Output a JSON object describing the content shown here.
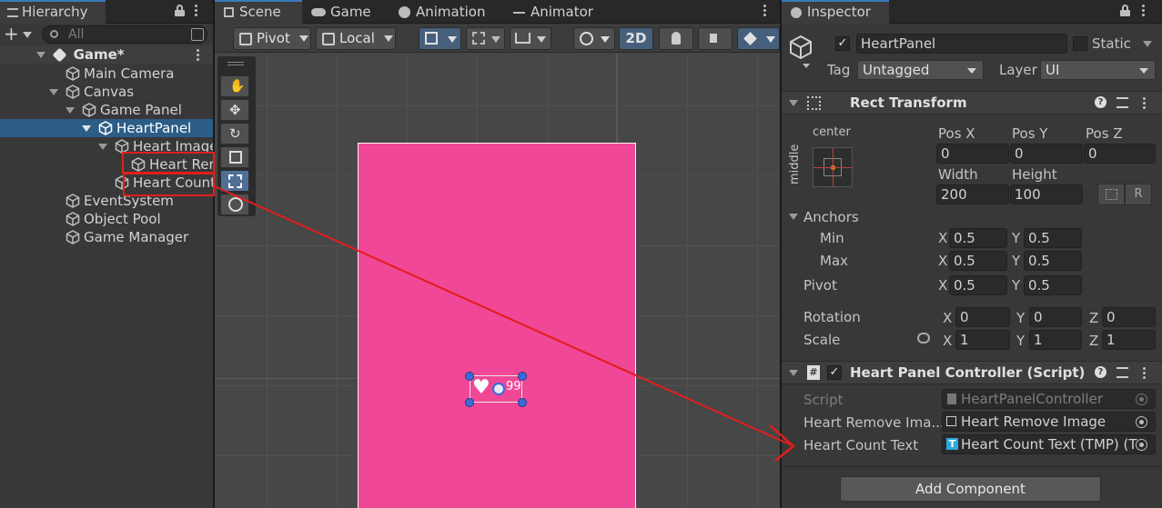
{
  "hierarchy": {
    "tab": "Hierarchy",
    "search_placeholder": "All",
    "scene_name": "Game*",
    "items": [
      {
        "label": "Main Camera"
      },
      {
        "label": "Canvas"
      },
      {
        "label": "Game Panel"
      },
      {
        "label": "HeartPanel"
      },
      {
        "label": "Heart Image"
      },
      {
        "label": "Heart Rer"
      },
      {
        "label": "Heart Count"
      },
      {
        "label": "EventSystem"
      },
      {
        "label": "Object Pool"
      },
      {
        "label": "Game Manager"
      }
    ]
  },
  "scene": {
    "tabs": [
      "Scene",
      "Game",
      "Animation",
      "Animator"
    ],
    "toolbar": {
      "pivot": "Pivot",
      "local": "Local",
      "mode_2d": "2D"
    },
    "heart_count_label": "99",
    "panel_color": "#f04796"
  },
  "inspector": {
    "tab": "Inspector",
    "object_name": "HeartPanel",
    "static_label": "Static",
    "tag_label": "Tag",
    "tag_value": "Untagged",
    "layer_label": "Layer",
    "layer_value": "UI",
    "rect_transform": {
      "title": "Rect Transform",
      "anchor_h": "center",
      "anchor_v": "middle",
      "pos_x_label": "Pos X",
      "pos_x": "0",
      "pos_y_label": "Pos Y",
      "pos_y": "0",
      "pos_z_label": "Pos Z",
      "pos_z": "0",
      "width_label": "Width",
      "width": "200",
      "height_label": "Height",
      "height": "100",
      "anchors_label": "Anchors",
      "min_label": "Min",
      "min_x": "0.5",
      "min_y": "0.5",
      "max_label": "Max",
      "max_x": "0.5",
      "max_y": "0.5",
      "pivot_label": "Pivot",
      "pivot_x": "0.5",
      "pivot_y": "0.5",
      "rotation_label": "Rotation",
      "rot_x": "0",
      "rot_y": "0",
      "rot_z": "0",
      "scale_label": "Scale",
      "scale_x": "1",
      "scale_y": "1",
      "scale_z": "1",
      "x": "X",
      "y": "Y",
      "z": "Z",
      "r_button": "R"
    },
    "script_component": {
      "title": "Heart Panel Controller (Script)",
      "script_label": "Script",
      "script_value": "HeartPanelController",
      "heart_remove_label": "Heart Remove Ima...",
      "heart_remove_value": "Heart Remove Image",
      "heart_count_label": "Heart Count Text",
      "heart_count_value": "Heart Count Text (TMP) (T"
    },
    "add_component": "Add Component"
  },
  "colors": {
    "accent": "#2c5d87",
    "annotation": "#e01e1e"
  }
}
